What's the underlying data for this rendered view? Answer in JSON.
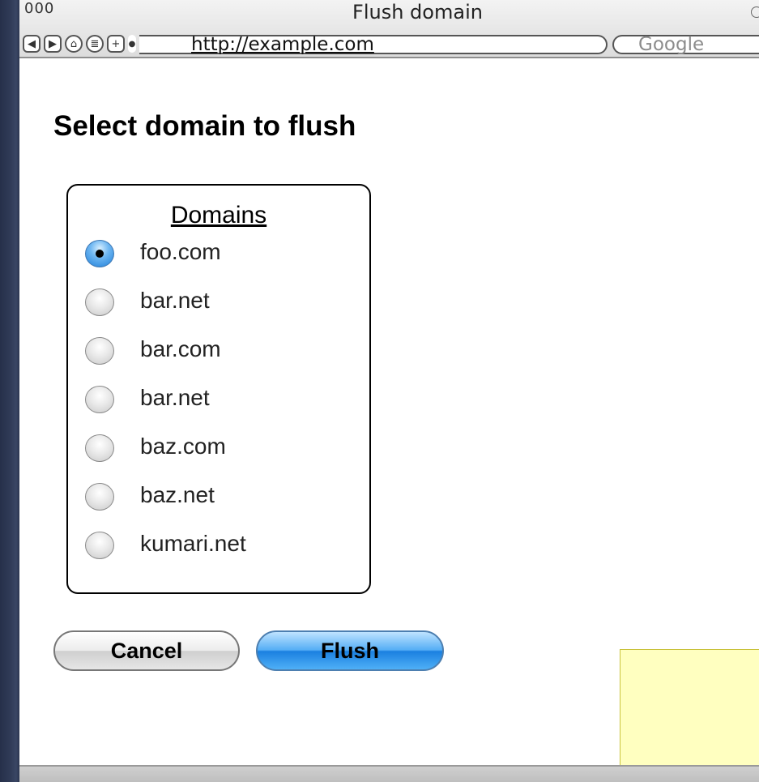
{
  "window": {
    "title": "Flush domain",
    "traffic_lights": "000",
    "url": "http://example.com",
    "search_placeholder": "Google"
  },
  "nav_buttons": [
    "back",
    "forward",
    "home",
    "print",
    "add",
    "stop"
  ],
  "page": {
    "heading": "Select domain to flush",
    "domains_heading": "Domains",
    "domains": [
      {
        "label": "foo.com",
        "selected": true
      },
      {
        "label": "bar.net",
        "selected": false
      },
      {
        "label": "bar.com",
        "selected": false
      },
      {
        "label": "bar.net",
        "selected": false
      },
      {
        "label": "baz.com",
        "selected": false
      },
      {
        "label": "baz.net",
        "selected": false
      },
      {
        "label": "kumari.net",
        "selected": false
      }
    ],
    "cancel_label": "Cancel",
    "flush_label": "Flush"
  },
  "colors": {
    "accent": "#1e7fd9",
    "sticky_note": "#ffffc0"
  }
}
